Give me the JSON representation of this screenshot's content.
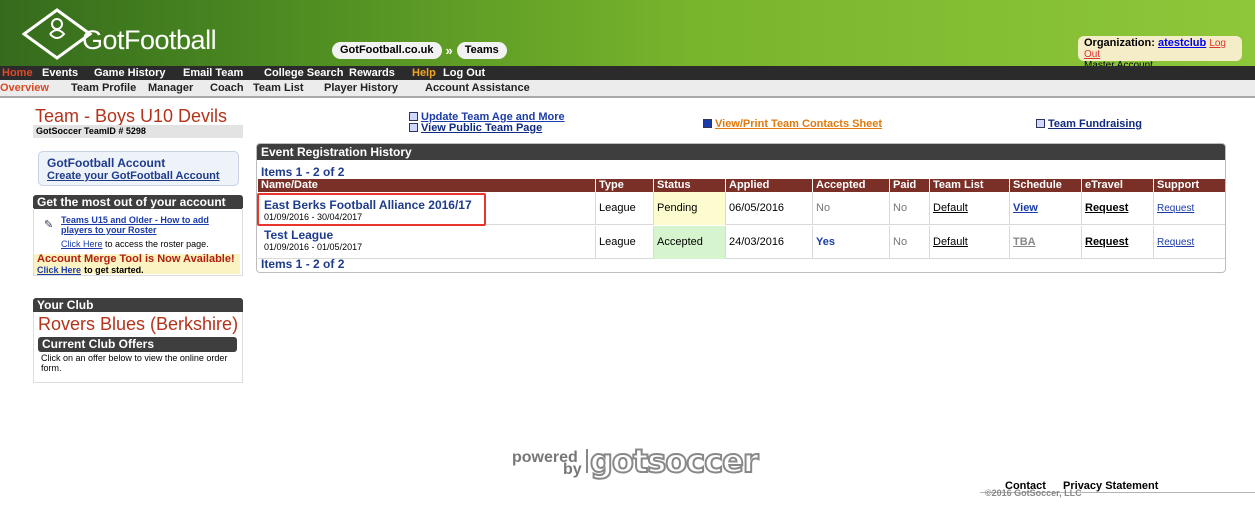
{
  "header": {
    "logo_text": "GotFootball",
    "crumb_site": "GotFootball.co.uk",
    "crumb_arrow": "»",
    "crumb_page": "Teams",
    "org_label": "Organization:",
    "org_name": "atestclub",
    "logout": "Log Out",
    "account_type": "Master Account"
  },
  "nav_primary": {
    "home": "Home",
    "events": "Events",
    "game_history": "Game History",
    "email_team": "Email Team",
    "college_search": "College Search",
    "rewards": "Rewards",
    "help": "Help",
    "log_out": "Log Out"
  },
  "nav_secondary": {
    "overview": "Overview",
    "team_profile": "Team Profile",
    "manager": "Manager",
    "coach": "Coach",
    "team_list": "Team List",
    "player_history": "Player History",
    "account_assistance": "Account Assistance"
  },
  "team": {
    "title": "Team -  Boys U10 Devils",
    "team_id": "GotSoccer TeamID # 5298"
  },
  "top_links": {
    "update_age": "Update Team Age and More",
    "view_public": "View Public Team Page",
    "print_contacts": "View/Print Team Contacts Sheet",
    "fundraising": "Team Fundraising"
  },
  "account_box": {
    "title": "GotFootball Account",
    "link": "Create your GotFootball Account"
  },
  "most_box": {
    "header": "Get the most out of your account",
    "link": "Teams U15 and Older - How to add players to your Roster",
    "click_here": "Click Here",
    "click_rest": "to access the roster page.",
    "merge_title": "Account Merge Tool is Now Available!",
    "merge_link": "Click Here",
    "merge_rest": "to get started."
  },
  "club_box": {
    "header": "Your Club",
    "club_name": "Rovers Blues (Berkshire)",
    "offers_header": "Current Club Offers",
    "offers_text": "Click on an offer below to view the online order form."
  },
  "registration": {
    "header": "Event Registration History",
    "items_top": "Items 1 - 2 of 2",
    "items_bottom": "Items 1 - 2 of 2",
    "columns": [
      "Name/Date",
      "Type",
      "Status",
      "Applied",
      "Accepted",
      "Paid",
      "Team List",
      "Schedule",
      "eTravel",
      "Support"
    ],
    "rows": [
      {
        "name": "East Berks Football Alliance 2016/17",
        "dates": "01/09/2016 - 30/04/2017",
        "type": "League",
        "status": "Pending",
        "applied": "06/05/2016",
        "accepted": "No",
        "paid": "No",
        "team_list": "Default",
        "schedule": "View",
        "etravel": "Request",
        "support": "Request"
      },
      {
        "name": "Test League",
        "dates": "01/09/2016 - 01/05/2017",
        "type": "League",
        "status": "Accepted",
        "applied": "24/03/2016",
        "accepted": "Yes",
        "paid": "No",
        "team_list": "Default",
        "schedule": "TBA",
        "etravel": "Request",
        "support": "Request"
      }
    ]
  },
  "footer": {
    "powered": "powered",
    "by": "by",
    "brand": "gotsoccer",
    "contact": "Contact",
    "privacy": "Privacy Statement",
    "copyright": "©2016 GotSoccer, LLC"
  },
  "colors": {
    "header_green": "#78b42c",
    "accent_red": "#b4331b",
    "table_header": "#7a2f27",
    "pending_bg": "#fdfccf",
    "accepted_bg": "#d6f5cf",
    "highlight": "#e8342a"
  }
}
